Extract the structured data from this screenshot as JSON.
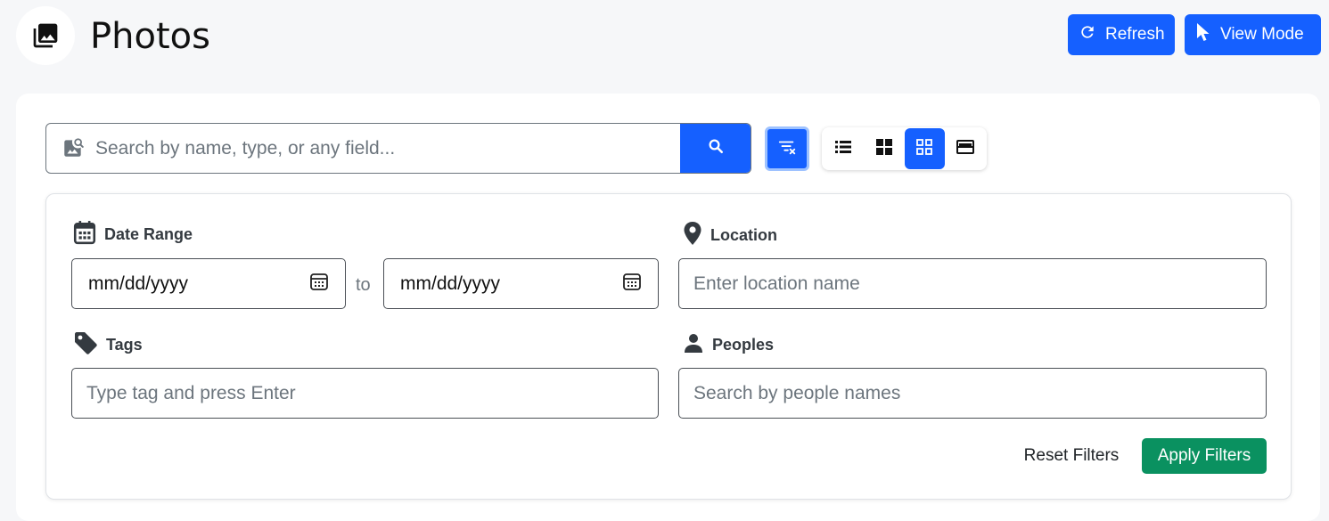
{
  "header": {
    "title": "Photos",
    "refresh_label": "Refresh",
    "view_mode_label": "View Mode"
  },
  "search": {
    "placeholder": "Search by name, type, or any field..."
  },
  "view_modes": [
    "list",
    "grid-large",
    "grid-small",
    "card"
  ],
  "active_view_mode": "grid-small",
  "filters": {
    "date_range_label": "Date Range",
    "date_from_value": "mm/dd/yyyy",
    "to_label": "to",
    "date_to_value": "mm/dd/yyyy",
    "location_label": "Location",
    "location_placeholder": "Enter location name",
    "tags_label": "Tags",
    "tags_placeholder": "Type tag and press Enter",
    "peoples_label": "Peoples",
    "peoples_placeholder": "Search by people names",
    "reset_label": "Reset Filters",
    "apply_label": "Apply Filters"
  },
  "colors": {
    "primary": "#1560ff",
    "success": "#0a9160",
    "background": "#f6f7f9"
  }
}
